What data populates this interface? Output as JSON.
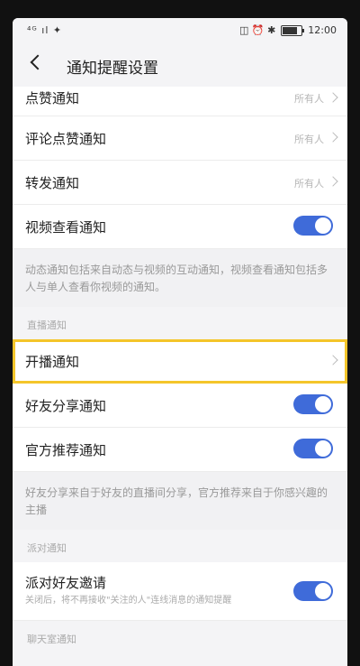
{
  "status_bar": {
    "signal": "⁴ᴳ ıl ✦",
    "time": "12:00",
    "icons": "◫ ⏰ ✱"
  },
  "header": {
    "title": "通知提醒设置"
  },
  "rows_top": [
    {
      "label": "点赞通知",
      "value": "所有人"
    },
    {
      "label": "评论点赞通知",
      "value": "所有人"
    },
    {
      "label": "转发通知",
      "value": "所有人"
    }
  ],
  "video_row": {
    "label": "视频查看通知",
    "on": true
  },
  "note1": "动态通知包括来自动态与视频的互动通知，视频查看通知包括多人与单人查看你视频的通知。",
  "live_section": {
    "header": "直播通知"
  },
  "live_rows": [
    {
      "label": "开播通知"
    },
    {
      "label": "好友分享通知",
      "on": true
    },
    {
      "label": "官方推荐通知",
      "on": true
    }
  ],
  "note2": "好友分享来自于好友的直播间分享，官方推荐来自于你感兴趣的主播",
  "party_section": {
    "header": "派对通知"
  },
  "party_row": {
    "label": "派对好友邀请",
    "sub": "关闭后，将不再接收\"关注的人\"连线消息的通知提醒",
    "on": true
  },
  "chat_section": {
    "header": "聊天室通知"
  }
}
